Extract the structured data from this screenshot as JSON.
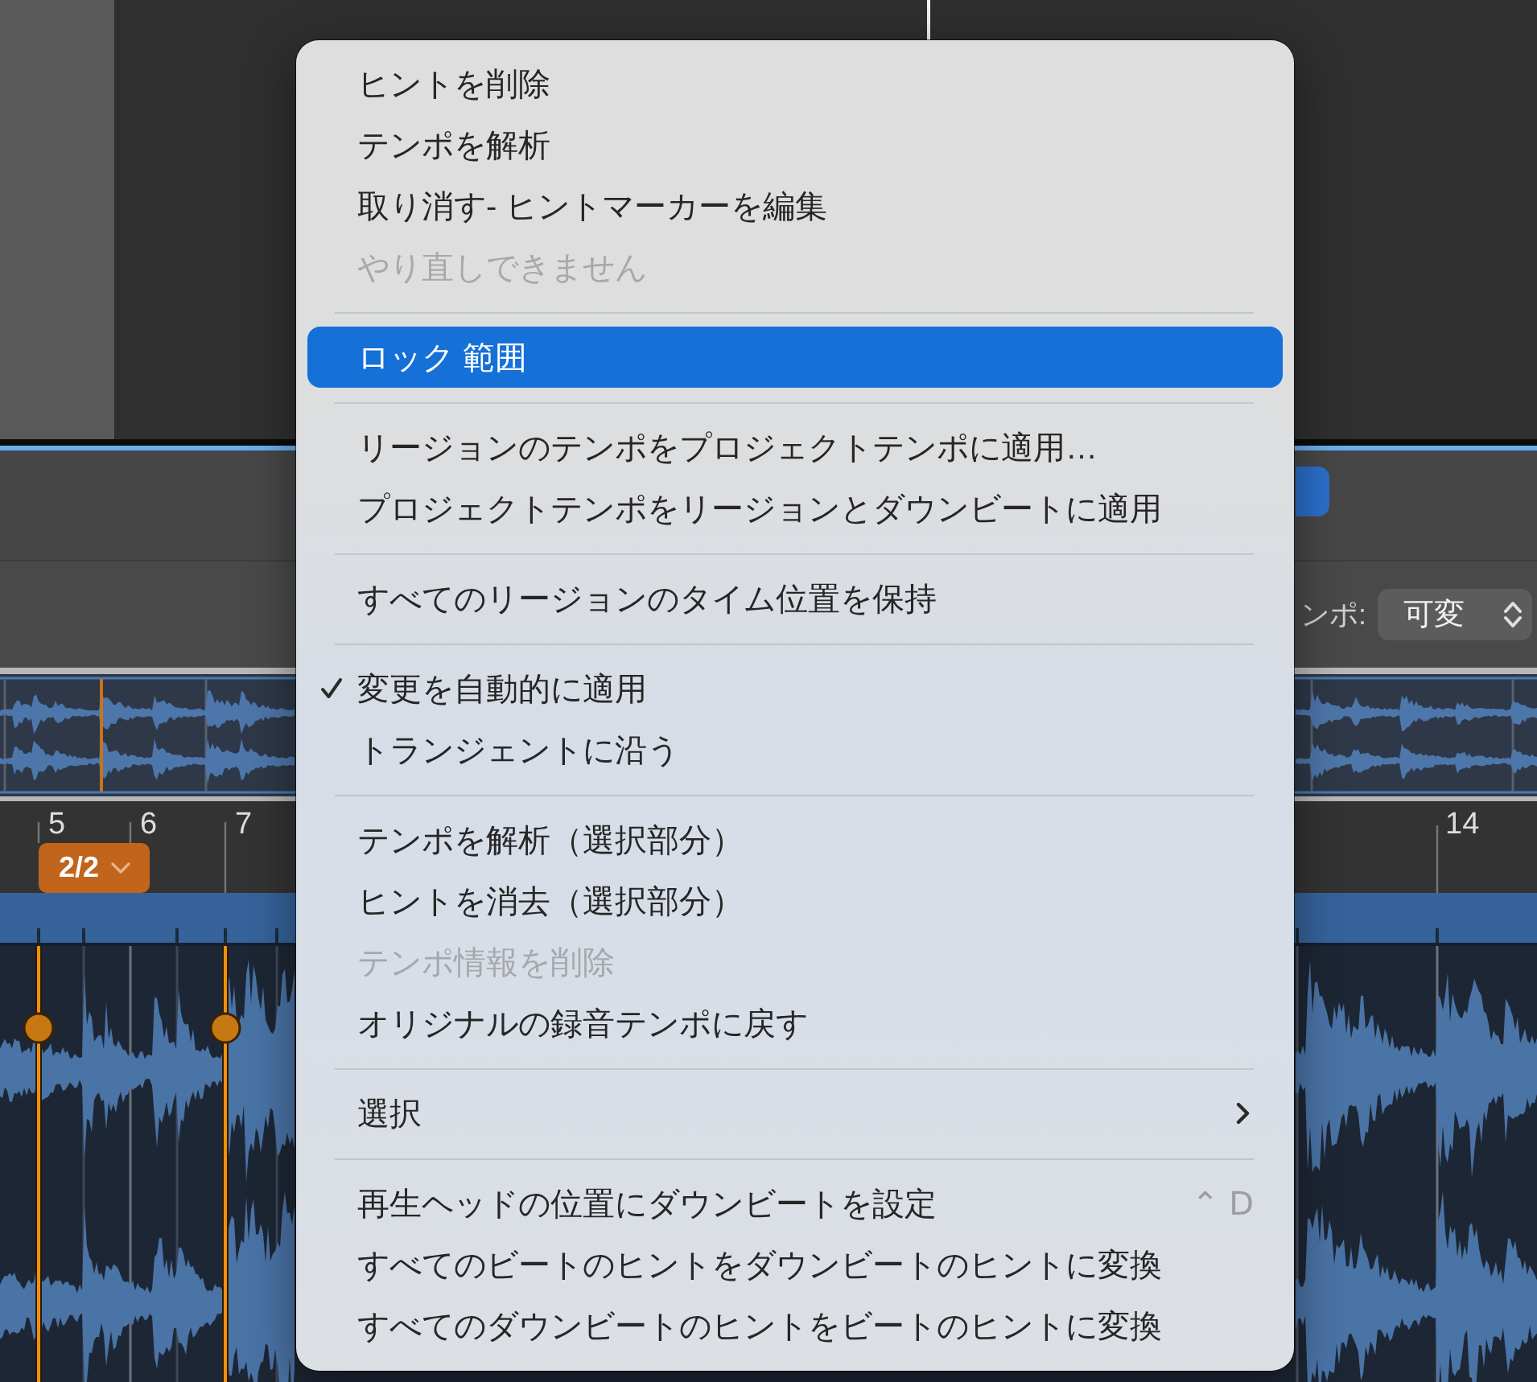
{
  "editor": {
    "toolbar": {
      "tempo_label": "ンポ:",
      "tempo_mode": "可変"
    },
    "ruler": {
      "bars": [
        "5",
        "6",
        "7",
        "14"
      ],
      "time_signature": "2/2"
    }
  },
  "context_menu": {
    "sections": [
      {
        "items": [
          {
            "label": "ヒントを削除",
            "selected": false,
            "disabled": false,
            "checked": false,
            "submenu": false
          },
          {
            "label": "テンポを解析",
            "selected": false,
            "disabled": false,
            "checked": false,
            "submenu": false
          },
          {
            "label": "取り消す- ヒントマーカーを編集",
            "selected": false,
            "disabled": false,
            "checked": false,
            "submenu": false
          },
          {
            "label": "やり直しできません",
            "selected": false,
            "disabled": true,
            "checked": false,
            "submenu": false
          }
        ]
      },
      {
        "items": [
          {
            "label": "ロック 範囲",
            "selected": true,
            "disabled": false,
            "checked": false,
            "submenu": false
          }
        ]
      },
      {
        "items": [
          {
            "label": "リージョンのテンポをプロジェクトテンポに適用…",
            "selected": false,
            "disabled": false,
            "checked": false,
            "submenu": false
          },
          {
            "label": "プロジェクトテンポをリージョンとダウンビートに適用",
            "selected": false,
            "disabled": false,
            "checked": false,
            "submenu": false
          }
        ]
      },
      {
        "items": [
          {
            "label": "すべてのリージョンのタイム位置を保持",
            "selected": false,
            "disabled": false,
            "checked": false,
            "submenu": false
          }
        ]
      },
      {
        "items": [
          {
            "label": "変更を自動的に適用",
            "selected": false,
            "disabled": false,
            "checked": true,
            "submenu": false
          },
          {
            "label": "トランジェントに沿う",
            "selected": false,
            "disabled": false,
            "checked": false,
            "submenu": false
          }
        ]
      },
      {
        "items": [
          {
            "label": "テンポを解析（選択部分）",
            "selected": false,
            "disabled": false,
            "checked": false,
            "submenu": false
          },
          {
            "label": "ヒントを消去（選択部分）",
            "selected": false,
            "disabled": false,
            "checked": false,
            "submenu": false
          },
          {
            "label": "テンポ情報を削除",
            "selected": false,
            "disabled": true,
            "checked": false,
            "submenu": false
          },
          {
            "label": "オリジナルの録音テンポに戻す",
            "selected": false,
            "disabled": false,
            "checked": false,
            "submenu": false
          }
        ]
      },
      {
        "items": [
          {
            "label": "選択",
            "selected": false,
            "disabled": false,
            "checked": false,
            "submenu": true
          }
        ]
      },
      {
        "items": [
          {
            "label": "再生ヘッドの位置にダウンビートを設定",
            "selected": false,
            "disabled": false,
            "checked": false,
            "submenu": false,
            "shortcut": "⌃ D"
          },
          {
            "label": "すべてのビートのヒントをダウンビートのヒントに変換",
            "selected": false,
            "disabled": false,
            "checked": false,
            "submenu": false
          },
          {
            "label": "すべてのダウンビートのヒントをビートのヒントに変換",
            "selected": false,
            "disabled": false,
            "checked": false,
            "submenu": false
          }
        ]
      }
    ]
  }
}
